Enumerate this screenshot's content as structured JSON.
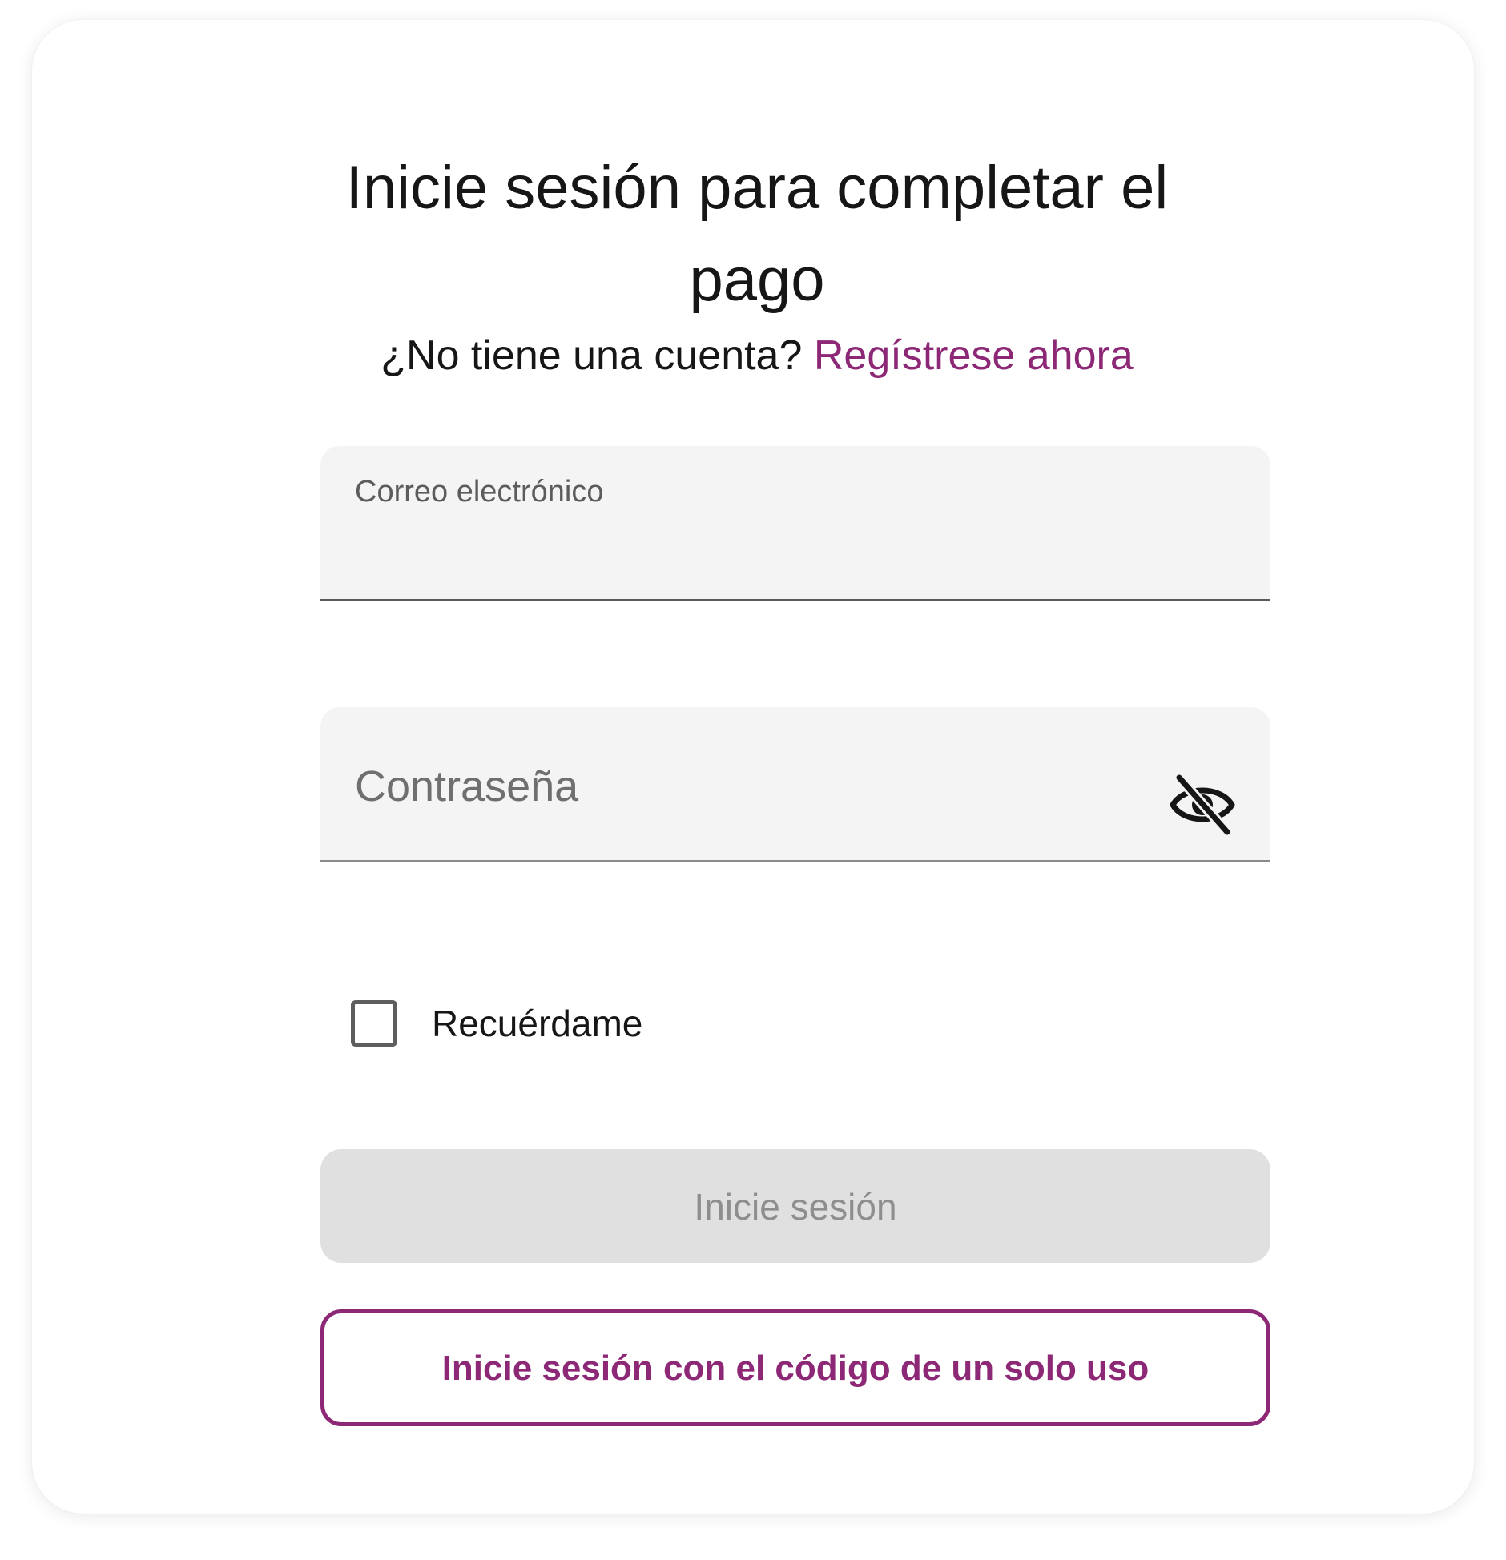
{
  "header": {
    "title": "Inicie sesión para completar el pago",
    "signup_prompt": "¿No tiene una cuenta?",
    "signup_link": "Regístrese ahora"
  },
  "form": {
    "email": {
      "label": "Correo electrónico",
      "value": ""
    },
    "password": {
      "label": "Contraseña",
      "value": "",
      "toggle_icon": "eye-slash-icon"
    },
    "remember_me": {
      "label": "Recuérdame",
      "checked": false
    },
    "submit_label": "Inicie sesión",
    "one_time_code_label": "Inicie sesión con el código de un solo uso"
  },
  "colors": {
    "accent": "#8c2875",
    "field_background": "#f4f4f4",
    "disabled_button": "#e0e0e0",
    "disabled_text": "#8e8e8e"
  }
}
